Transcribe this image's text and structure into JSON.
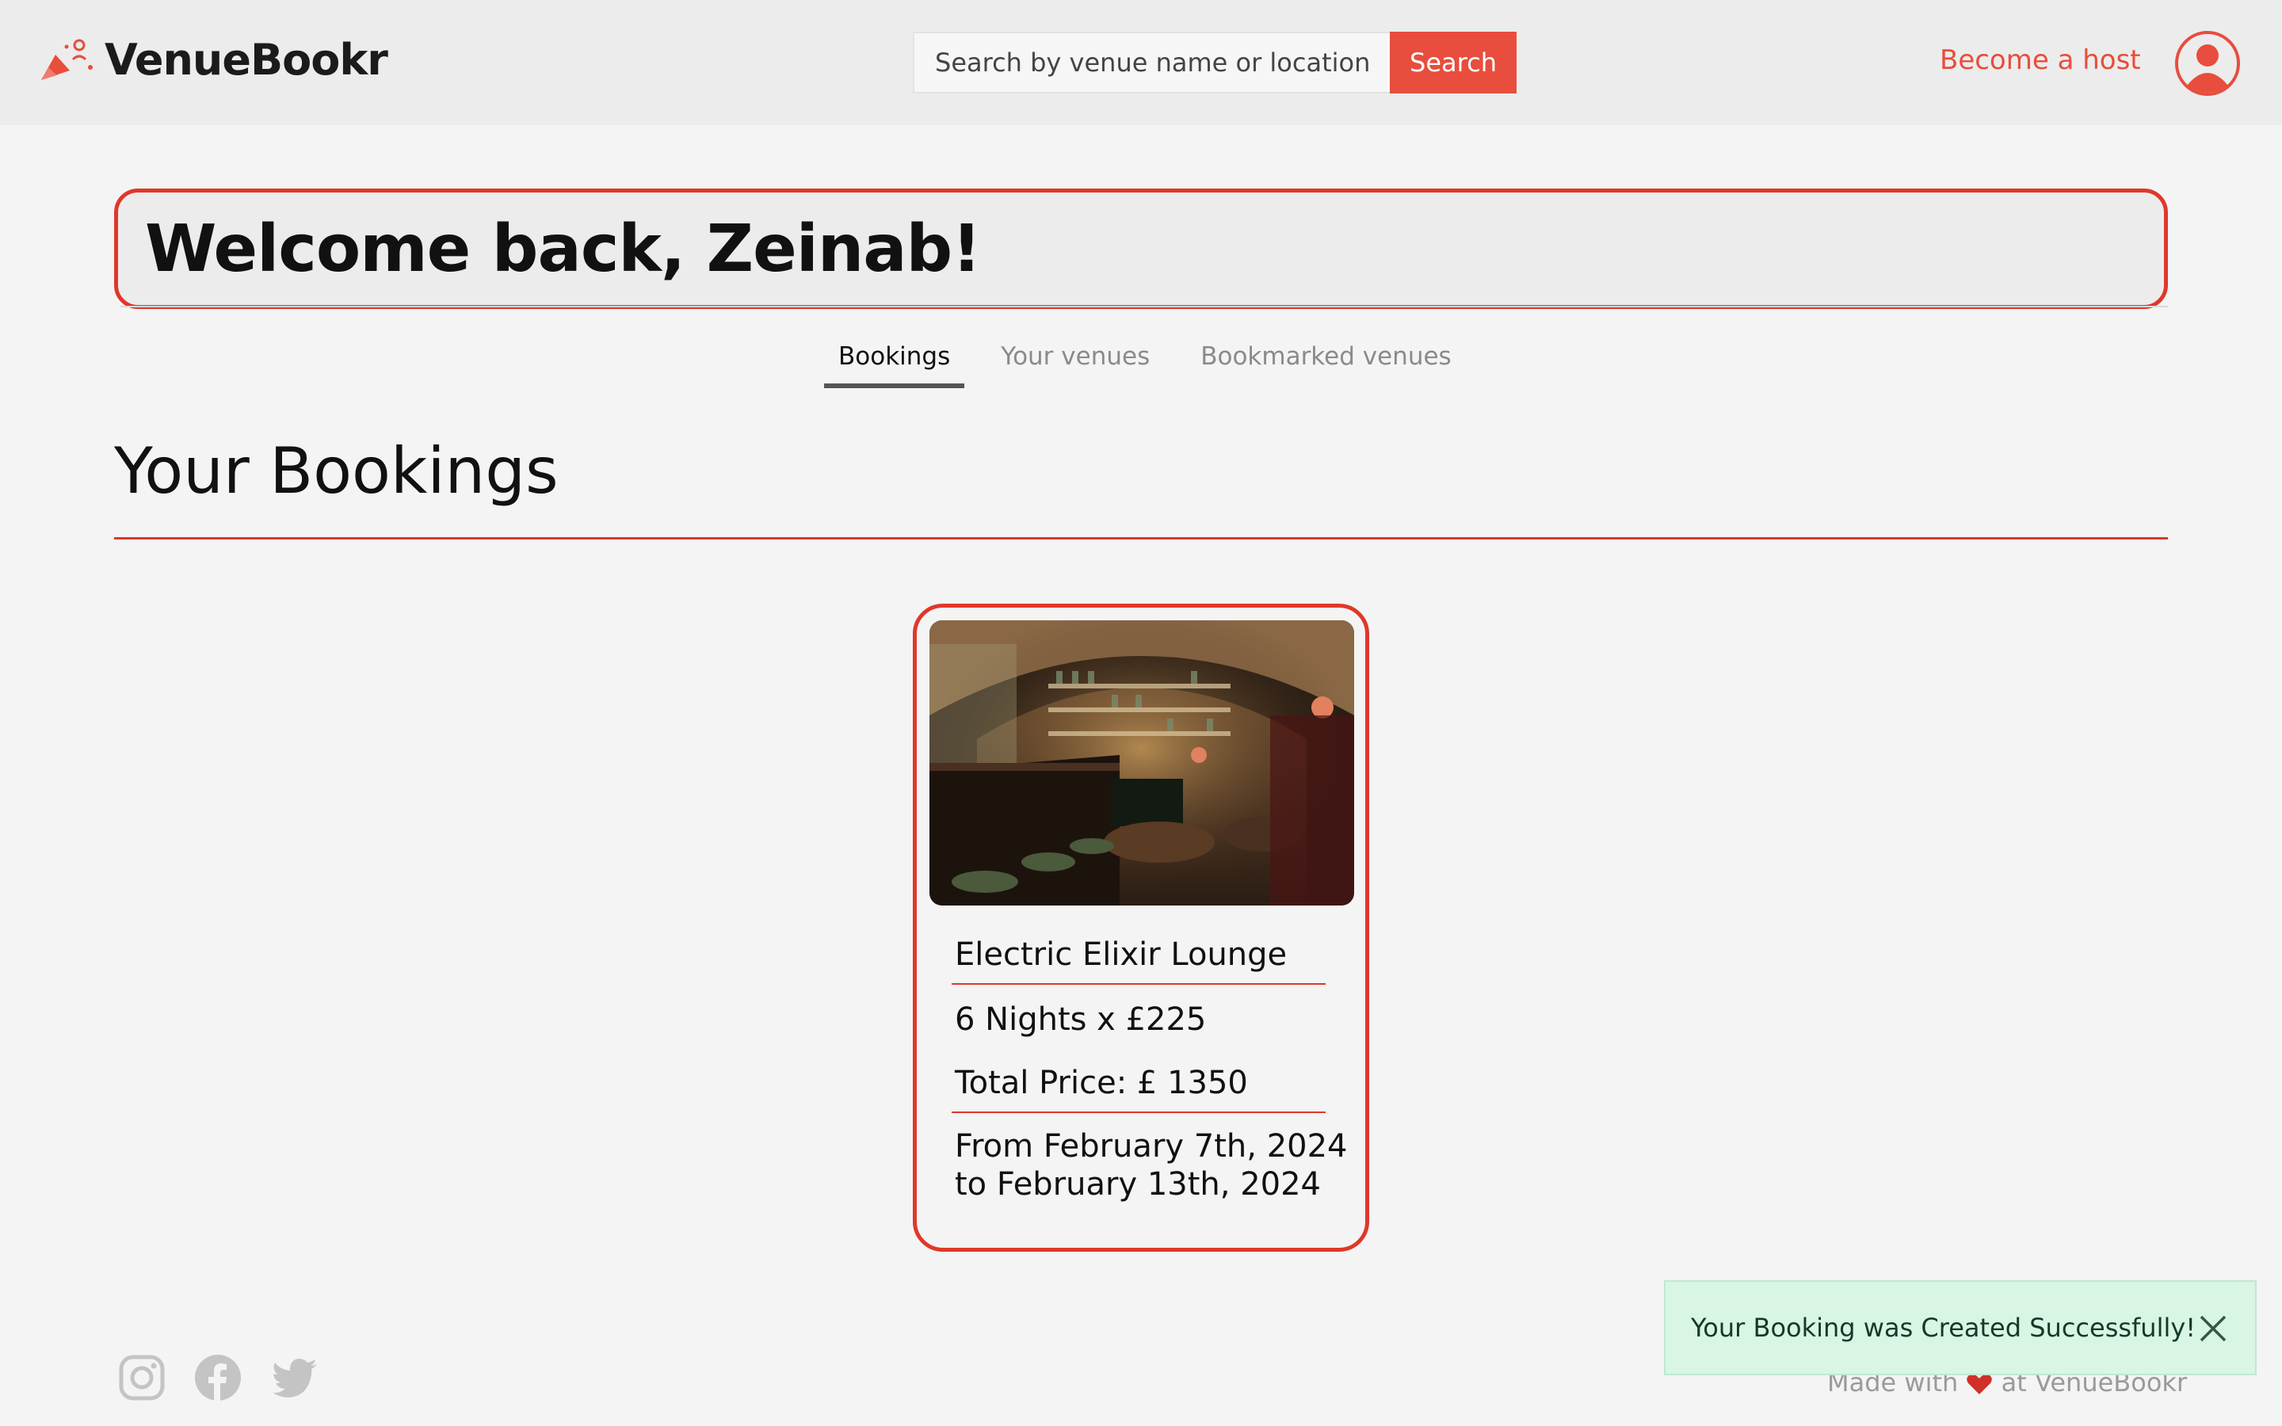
{
  "header": {
    "brand": "VenueBookr",
    "search_placeholder": "Search by venue name or location",
    "search_button": "Search",
    "host_link": "Become a host"
  },
  "welcome": {
    "heading": "Welcome back, Zeinab!"
  },
  "tabs": [
    {
      "label": "Bookings",
      "active": true
    },
    {
      "label": "Your venues",
      "active": false
    },
    {
      "label": "Bookmarked venues",
      "active": false
    }
  ],
  "section": {
    "title": "Your Bookings"
  },
  "booking": {
    "venue_name": "Electric Elixir Lounge",
    "nights_line": "6 Nights x £225",
    "total_line": "Total Price: £ 1350",
    "date_from": "From February 7th, 2024",
    "date_to": "to February 13th, 2024"
  },
  "footer": {
    "made_with_prefix": "Made with",
    "made_with_suffix": "at VenueBookr",
    "social_icons": [
      "instagram-icon",
      "facebook-icon",
      "twitter-icon"
    ]
  },
  "toast": {
    "message": "Your Booking was Created Successfully!"
  },
  "colors": {
    "accent": "#e84d3d",
    "border": "#e0372a",
    "toast_bg": "#d9f5e3"
  }
}
